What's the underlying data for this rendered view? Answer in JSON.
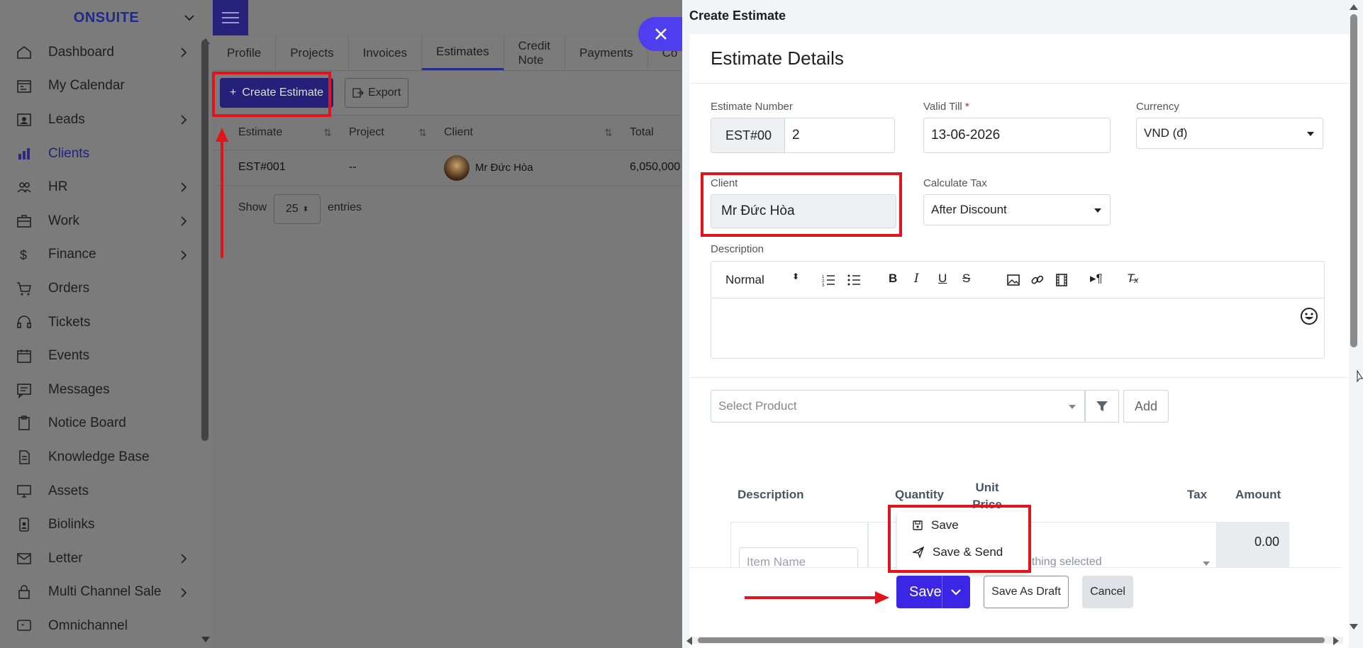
{
  "brand": {
    "name": "ONSUITE"
  },
  "sidebar": {
    "items": [
      {
        "label": "Dashboard",
        "icon": "home-icon",
        "has_arrow": true
      },
      {
        "label": "My Calendar",
        "icon": "calendar-icon",
        "has_arrow": false
      },
      {
        "label": "Leads",
        "icon": "leads-icon",
        "has_arrow": true
      },
      {
        "label": "Clients",
        "icon": "clients-icon",
        "has_arrow": false,
        "active": true
      },
      {
        "label": "HR",
        "icon": "users-icon",
        "has_arrow": true
      },
      {
        "label": "Work",
        "icon": "briefcase-icon",
        "has_arrow": true
      },
      {
        "label": "Finance",
        "icon": "dollar-icon",
        "has_arrow": true
      },
      {
        "label": "Orders",
        "icon": "cart-icon",
        "has_arrow": false
      },
      {
        "label": "Tickets",
        "icon": "headset-icon",
        "has_arrow": false
      },
      {
        "label": "Events",
        "icon": "event-calendar-icon",
        "has_arrow": false
      },
      {
        "label": "Messages",
        "icon": "message-icon",
        "has_arrow": false
      },
      {
        "label": "Notice Board",
        "icon": "clipboard-icon",
        "has_arrow": false
      },
      {
        "label": "Knowledge Base",
        "icon": "document-icon",
        "has_arrow": false
      },
      {
        "label": "Assets",
        "icon": "monitor-icon",
        "has_arrow": false
      },
      {
        "label": "Biolinks",
        "icon": "badge-icon",
        "has_arrow": false
      },
      {
        "label": "Letter",
        "icon": "mail-icon",
        "has_arrow": true
      },
      {
        "label": "Multi Channel Sale",
        "icon": "lock-bag-icon",
        "has_arrow": true
      },
      {
        "label": "Omnichannel",
        "icon": "chat-icon",
        "has_arrow": false
      }
    ]
  },
  "tabs": [
    "Profile",
    "Projects",
    "Invoices",
    "Estimates",
    "Credit Note",
    "Payments",
    "Co"
  ],
  "toolbar": {
    "create_label": "Create Estimate",
    "export_label": "Export"
  },
  "table": {
    "headers": [
      "Estimate",
      "Project",
      "Client",
      "Total"
    ],
    "row": {
      "estimate": "EST#001",
      "project": "--",
      "client": "Mr Đức Hòa",
      "total": "6,050,000"
    },
    "show_label": "Show",
    "entries_value": "25",
    "entries_label": "entries"
  },
  "panel": {
    "title": "Create Estimate",
    "card_title": "Estimate Details",
    "estimate_number": {
      "label": "Estimate Number",
      "prefix": "EST#00",
      "value": "2"
    },
    "valid_till": {
      "label": "Valid Till",
      "required_mark": "*",
      "value": "13-06-2026"
    },
    "currency": {
      "label": "Currency",
      "value": "VND (đ)"
    },
    "client": {
      "label": "Client",
      "value": "Mr Đức Hòa"
    },
    "calculate_tax": {
      "label": "Calculate Tax",
      "value": "After Discount"
    },
    "description": {
      "label": "Description",
      "format": "Normal"
    },
    "product": {
      "placeholder": "Select Product",
      "add_label": "Add"
    },
    "items_table": {
      "headers": {
        "description": "Description",
        "quantity": "Quantity",
        "unit_price": "Unit Price",
        "tax": "Tax",
        "amount": "Amount"
      },
      "item_name_placeholder": "Item Name",
      "tax_placeholder": "othing selected",
      "amount_value": "0.00"
    },
    "dropdown": {
      "save": "Save",
      "save_send": "Save & Send"
    },
    "footer": {
      "save": "Save",
      "save_draft": "Save As Draft",
      "cancel": "Cancel"
    }
  },
  "colors": {
    "primary": "#3c26e6",
    "annotation": "#e1141c",
    "brand_text": "#1f2a8a"
  }
}
